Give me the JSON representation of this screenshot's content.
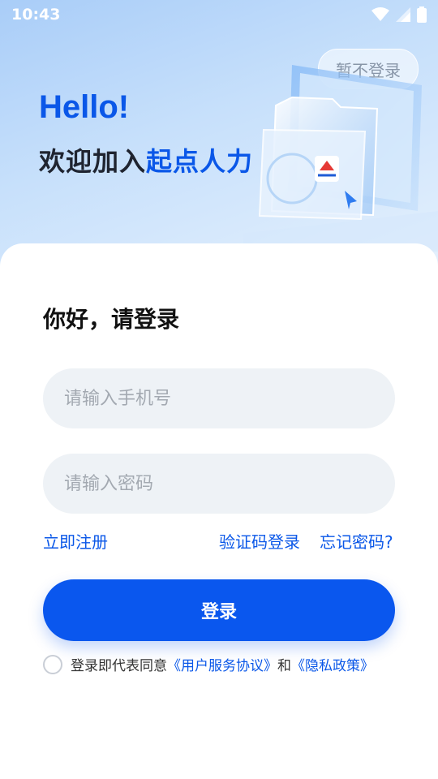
{
  "status": {
    "time": "10:43"
  },
  "header": {
    "skip_label": "暂不登录",
    "hello": "Hello!",
    "welcome_prefix": "欢迎加入",
    "welcome_brand": "起点人力"
  },
  "login": {
    "title": "你好，请登录",
    "phone_placeholder": "请输入手机号",
    "password_placeholder": "请输入密码",
    "register_link": "立即注册",
    "sms_login_link": "验证码登录",
    "forgot_link": "忘记密码?",
    "submit_label": "登录",
    "agreement_prefix": "登录即代表同意",
    "terms_link": "《用户服务协议》",
    "and_text": "和",
    "privacy_link": "《隐私政策》"
  },
  "colors": {
    "accent": "#0a57ee",
    "input_bg": "#eef2f6",
    "hero_bg": "#bcd9fa"
  },
  "icons": [
    "wifi-icon",
    "signal-icon",
    "battery-icon",
    "folder-illustration",
    "app-logo-icon",
    "cursor-icon"
  ]
}
